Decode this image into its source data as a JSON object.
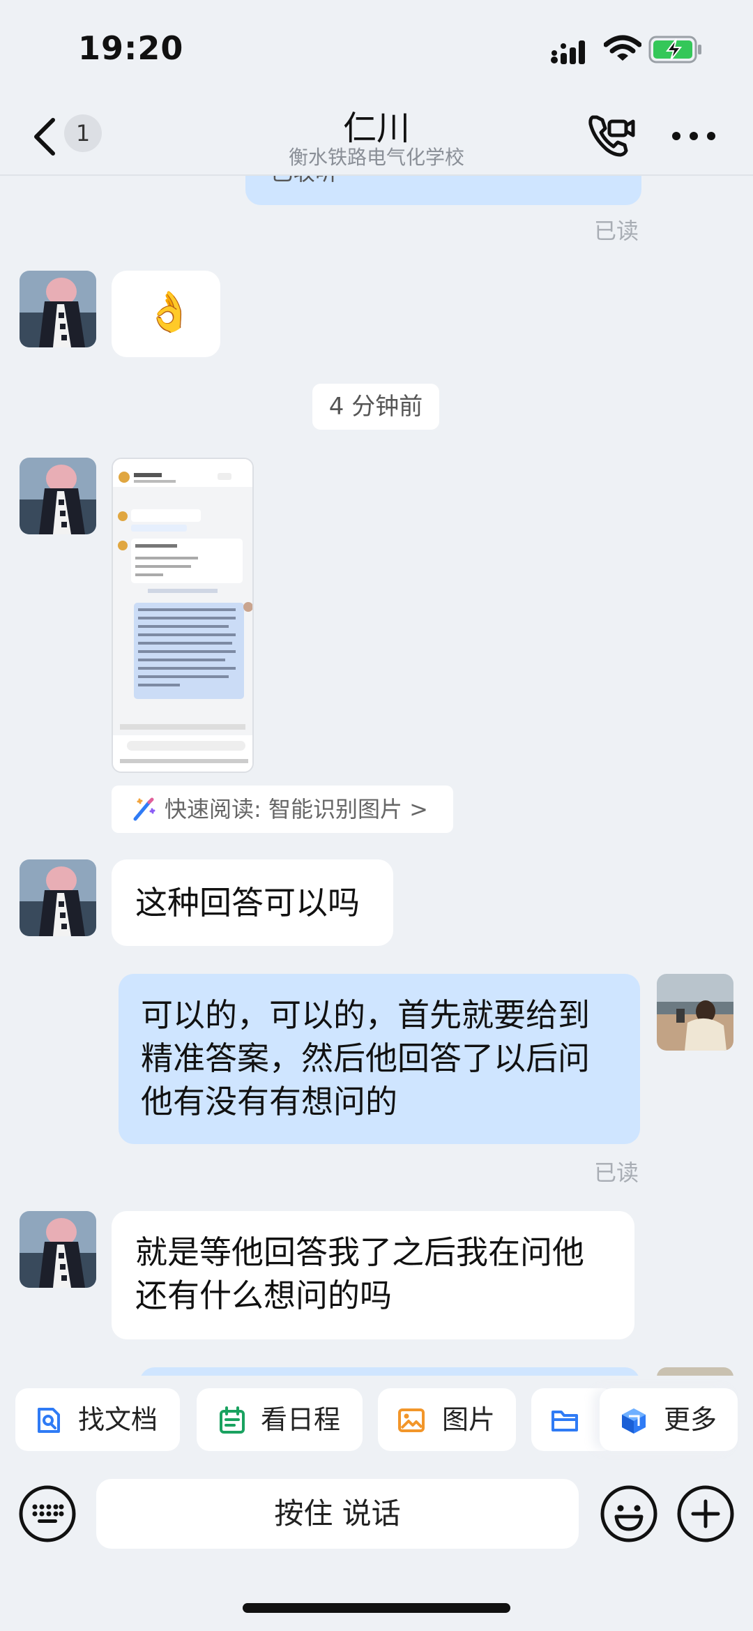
{
  "status_bar": {
    "time": "19:20"
  },
  "header": {
    "unread_count": "1",
    "title": "仁川",
    "subtitle": "衡水铁路电气化学校"
  },
  "messages": {
    "partial_top_text": "已收听",
    "read_label": "已读",
    "emoji": "👌",
    "time_divider": "4 分钟前",
    "quick_read": "快速阅读: 智能识别图片 >",
    "msg1": "这种回答可以吗",
    "msg2_line1": "可以的，可以的，首先就要给到",
    "msg2_line2": "精准答案，然后他回答了以后问",
    "msg2_line3": "他有没有有想问的",
    "msg3_line1": "就是等他回答我了之后我在问他",
    "msg3_line2": "还有什么想问的吗"
  },
  "shortcuts": {
    "find_docs": "找文档",
    "schedule": "看日程",
    "images": "图片",
    "more": "更多"
  },
  "input": {
    "hold_to_talk": "按住 说话"
  },
  "colors": {
    "background": "#eef1f5",
    "bubble_self": "#cfe5ff",
    "bubble_other": "#ffffff",
    "accent_blue": "#2f7bf5"
  },
  "icons": [
    "back-icon",
    "video-call-icon",
    "more-icon",
    "keyboard-icon",
    "emoji-icon",
    "plus-icon",
    "document-search-icon",
    "calendar-icon",
    "image-icon",
    "folder-icon",
    "cube-icon",
    "magic-wand-icon"
  ]
}
